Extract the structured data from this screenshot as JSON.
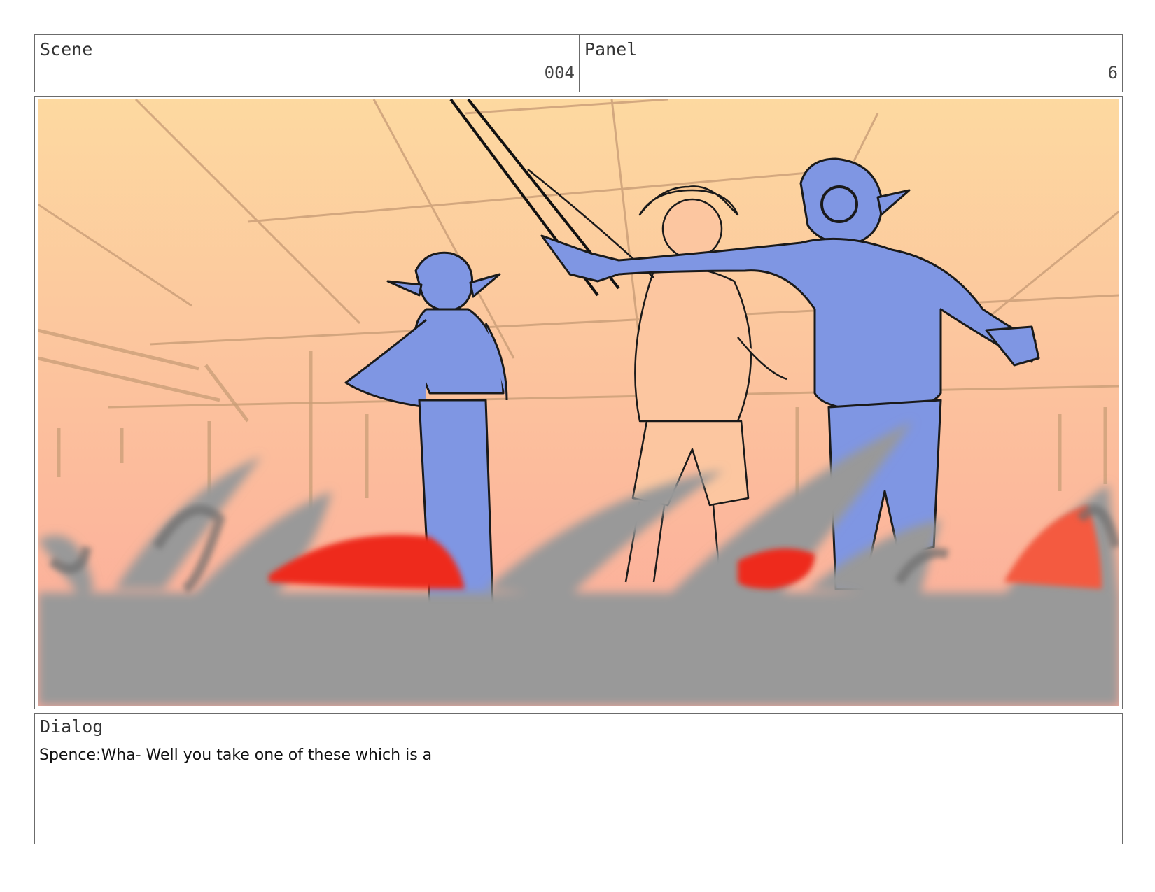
{
  "header": {
    "scene_label": "Scene",
    "scene_number": "004",
    "panel_label": "Panel",
    "panel_number": "6"
  },
  "frame": {
    "description_icon": "storyboard-sketch-icon",
    "colors": {
      "sky_top": "#fdd9a0",
      "sky_bottom": "#fcb49a",
      "character_fill": "#7f96e3",
      "foreground_gray": "#999999",
      "accent_red": "#ee2a1c"
    }
  },
  "dialog": {
    "label": "Dialog",
    "text": "Spence:Wha- Well you take one of these which is a"
  }
}
